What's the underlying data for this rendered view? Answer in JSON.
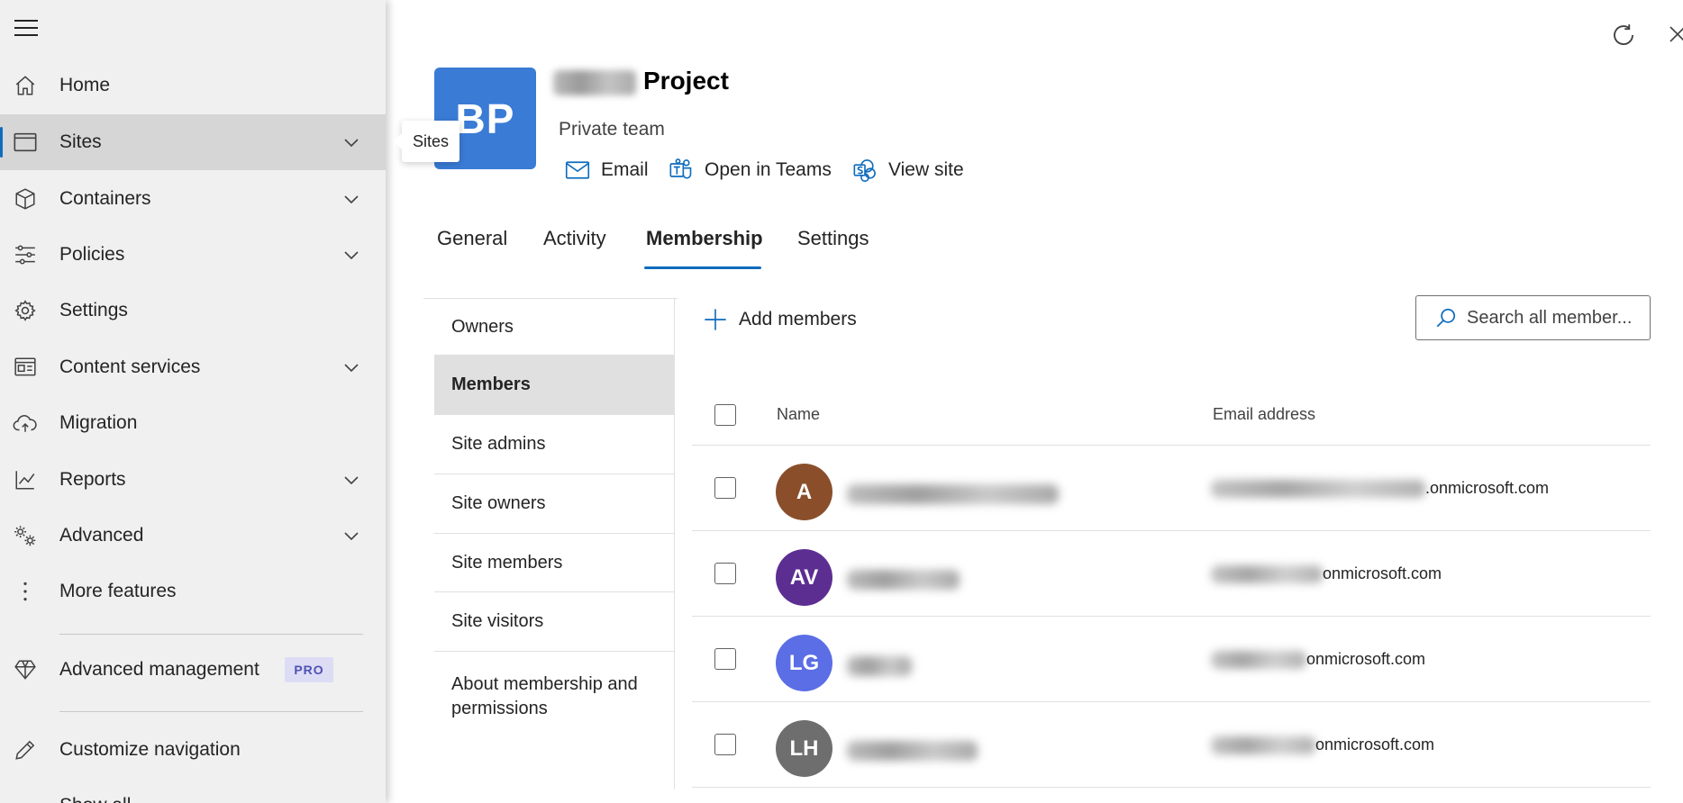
{
  "nav": {
    "items": [
      {
        "label": "Home",
        "icon": "home-icon"
      },
      {
        "label": "Sites",
        "icon": "sites-icon",
        "selected": true,
        "expandable": true
      },
      {
        "label": "Containers",
        "icon": "container-icon",
        "expandable": true
      },
      {
        "label": "Policies",
        "icon": "policies-icon",
        "expandable": true
      },
      {
        "label": "Settings",
        "icon": "gear-icon"
      },
      {
        "label": "Content services",
        "icon": "content-services-icon",
        "expandable": true
      },
      {
        "label": "Migration",
        "icon": "cloud-upload-icon"
      },
      {
        "label": "Reports",
        "icon": "chart-icon",
        "expandable": true
      },
      {
        "label": "Advanced",
        "icon": "gears-icon",
        "expandable": true
      },
      {
        "label": "More features",
        "icon": "more-vertical-icon"
      }
    ],
    "advanced_management": {
      "label": "Advanced management",
      "badge": "PRO",
      "icon": "diamond-icon"
    },
    "customize": {
      "label": "Customize navigation",
      "icon": "pencil-icon"
    },
    "partial_label": "Show all",
    "tooltip": "Sites",
    "accent_color": "#0f6cbd"
  },
  "site": {
    "logo_initials": "BP",
    "logo_color": "#3a7bd5",
    "title_suffix": "Project",
    "subtitle": "Private team",
    "actions": [
      {
        "label": "Email",
        "icon": "mail-icon"
      },
      {
        "label": "Open in Teams",
        "icon": "teams-icon"
      },
      {
        "label": "View site",
        "icon": "sharepoint-icon"
      }
    ]
  },
  "tabs": [
    {
      "label": "General"
    },
    {
      "label": "Activity"
    },
    {
      "label": "Membership",
      "active": true
    },
    {
      "label": "Settings"
    }
  ],
  "subnav": [
    {
      "label": "Owners"
    },
    {
      "label": "Members",
      "selected": true
    },
    {
      "label": "Site admins"
    },
    {
      "label": "Site owners"
    },
    {
      "label": "Site members"
    },
    {
      "label": "Site visitors"
    },
    {
      "label": "About membership and permissions"
    }
  ],
  "toolbar": {
    "add_label": "Add members",
    "search_placeholder": "Search all member..."
  },
  "table": {
    "columns": [
      "Name",
      "Email address"
    ],
    "rows": [
      {
        "initials": "A",
        "color": "#8a4f2a",
        "email_suffix": ".onmicrosoft.com"
      },
      {
        "initials": "AV",
        "color": "#5c2e91",
        "email_suffix": "onmicrosoft.com"
      },
      {
        "initials": "LG",
        "color": "#5b6ee6",
        "email_suffix": "onmicrosoft.com"
      },
      {
        "initials": "LH",
        "color": "#6e6e6e",
        "email_suffix": "onmicrosoft.com"
      }
    ]
  }
}
